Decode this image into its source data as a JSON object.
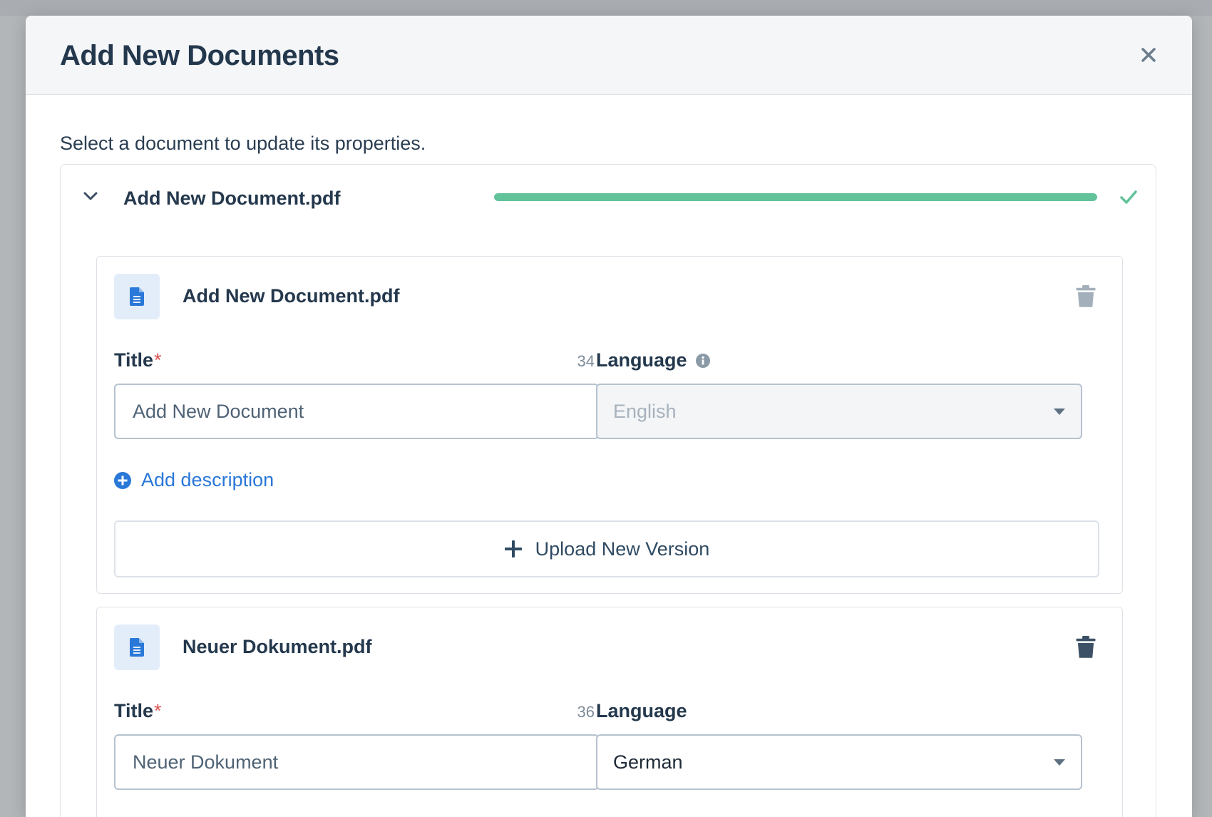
{
  "modal": {
    "title": "Add New Documents",
    "subtitle": "Select a document to update its properties."
  },
  "group": {
    "file_name": "Add New Document.pdf",
    "upload_progress_percent": 100,
    "status": "complete"
  },
  "documents": [
    {
      "file_name": "Add New Document.pdf",
      "title_label": "Title",
      "required_marker": "*",
      "title_counter": "34",
      "title_value": "Add New Document",
      "language_label": "Language",
      "language_value": "English",
      "language_disabled": true,
      "add_description_label": "Add description",
      "upload_version_label": "Upload New Version"
    },
    {
      "file_name": "Neuer Dokument.pdf",
      "title_label": "Title",
      "required_marker": "*",
      "title_counter": "36",
      "title_value": "Neuer Dokument",
      "language_label": "Language",
      "language_value": "German",
      "language_disabled": false
    }
  ],
  "colors": {
    "accent": "#2a78d8",
    "success": "#62c29a",
    "required": "#d9534f",
    "text": "#24384d"
  },
  "icons": [
    "close-icon",
    "chevron-down-icon",
    "check-icon",
    "file-icon",
    "trash-icon",
    "info-icon",
    "plus-circle-icon",
    "plus-icon",
    "caret-down-icon"
  ]
}
